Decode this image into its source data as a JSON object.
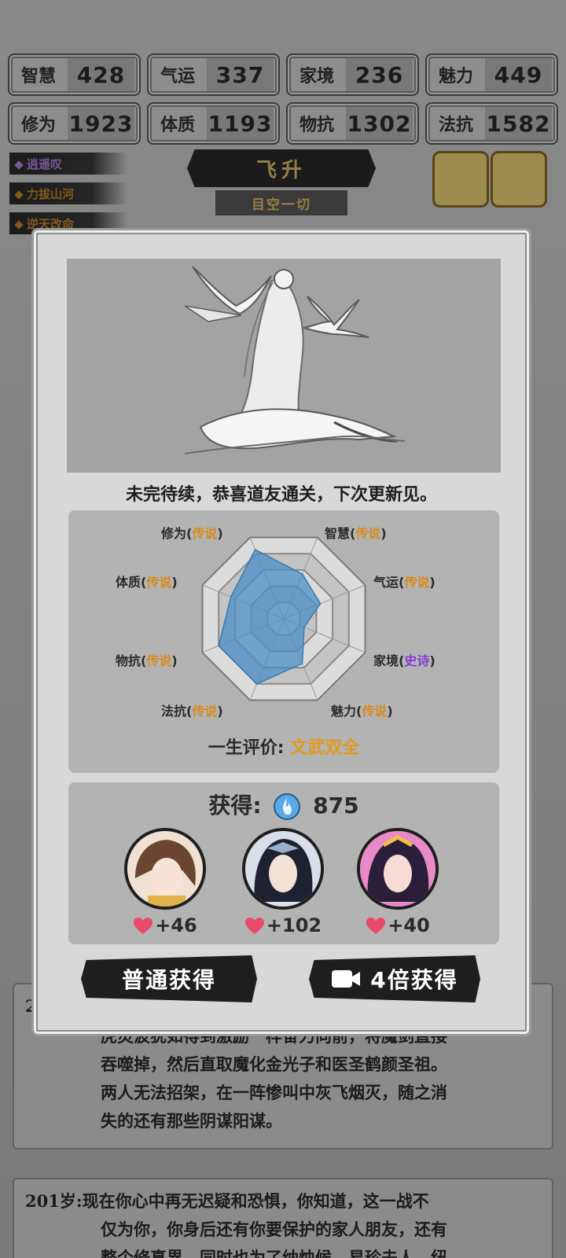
{
  "stats": [
    {
      "label": "智慧",
      "value": "428"
    },
    {
      "label": "气运",
      "value": "337"
    },
    {
      "label": "家境",
      "value": "236"
    },
    {
      "label": "魅力",
      "value": "449"
    },
    {
      "label": "修为",
      "value": "1923"
    },
    {
      "label": "体质",
      "value": "1193"
    },
    {
      "label": "物抗",
      "value": "1302"
    },
    {
      "label": "法抗",
      "value": "1582"
    }
  ],
  "tags": [
    "逍遥叹",
    "力拔山河",
    "逆天改命"
  ],
  "realm": {
    "title": "飞升",
    "subtitle": "目空一切"
  },
  "modal": {
    "message": "未完待续，恭喜道友通关，下次更新见。",
    "radar": [
      {
        "attr": "修为",
        "tier": "传说",
        "value": 0.85,
        "epic": false
      },
      {
        "attr": "智慧",
        "tier": "传说",
        "value": 0.55,
        "epic": false
      },
      {
        "attr": "气运",
        "tier": "传说",
        "value": 0.45,
        "epic": false
      },
      {
        "attr": "家境",
        "tier": "史诗",
        "value": 0.25,
        "epic": true
      },
      {
        "attr": "魅力",
        "tier": "传说",
        "value": 0.55,
        "epic": false
      },
      {
        "attr": "法抗",
        "tier": "传说",
        "value": 0.8,
        "epic": false
      },
      {
        "attr": "物抗",
        "tier": "传说",
        "value": 0.8,
        "epic": false
      },
      {
        "attr": "体质",
        "tier": "传说",
        "value": 0.65,
        "epic": false
      }
    ],
    "evaluation_label": "一生评价:",
    "evaluation_value": "文武双全",
    "reward_label": "获得:",
    "reward_amount": "875",
    "characters": [
      {
        "affinity": "+46"
      },
      {
        "affinity": "+102"
      },
      {
        "affinity": "+40"
      }
    ],
    "btn_normal": "普通获得",
    "btn_video": "4倍获得"
  },
  "log": {
    "entry1": {
      "age": "2",
      "lines": [
        "虎灵波犹如得到激励一样奋力向前，将魔剑直接",
        "吞噬掉，然后直取魔化金光子和医圣鹤颜圣祖。",
        "两人无法招架，在一阵惨叫中灰飞烟灭，随之消",
        "失的还有那些阴谋阳谋。"
      ]
    },
    "entry2": {
      "age": "201岁:",
      "lines": [
        "现在你心中再无迟疑和恐惧，你知道，这一战不",
        "仅为你，你身后还有你要保护的家人朋友，还有",
        "整个修真界，同时也为了纳烛候，易珍夫人，纽"
      ]
    }
  },
  "colors": {
    "legend": "#d98a1a",
    "epic": "#8a3ad8",
    "radar_fill": "#4a8fc8"
  }
}
